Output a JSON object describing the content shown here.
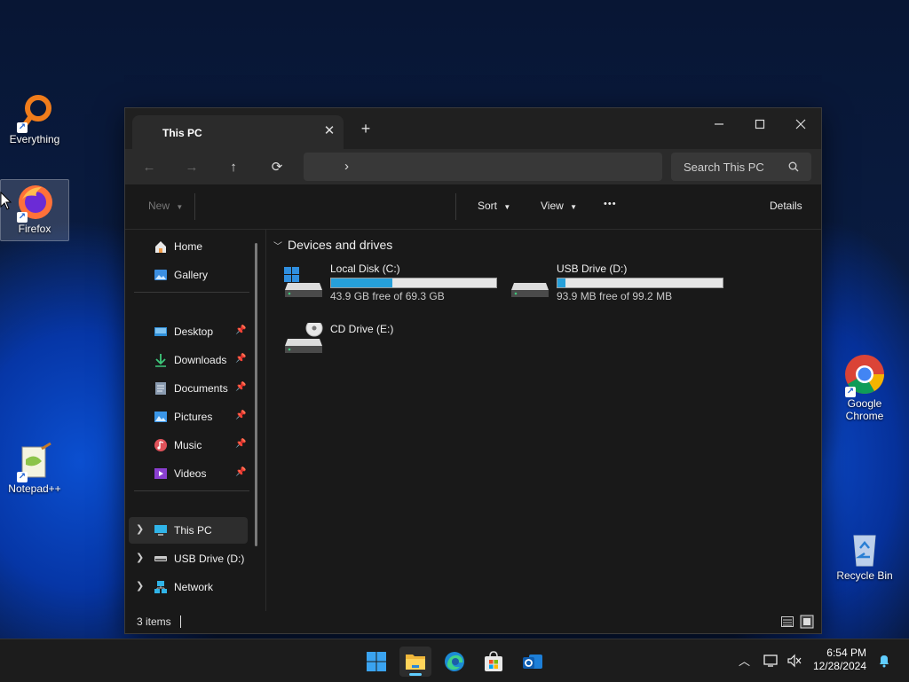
{
  "desktop": {
    "icons": [
      {
        "label": "Everything"
      },
      {
        "label": "Firefox"
      },
      {
        "label": "Notepad++"
      },
      {
        "label": "Google\nChrome",
        "line1": "Google",
        "line2": "Chrome"
      },
      {
        "label": "Recycle Bin"
      }
    ]
  },
  "window": {
    "tab_title": "This PC",
    "new_tab": "+",
    "nav": {
      "back": "←",
      "forward": "→",
      "up": "↑",
      "refresh": "⟳",
      "breadcrumb_sep": "›"
    },
    "search": {
      "placeholder": "Search This PC"
    },
    "commands": {
      "new": "New",
      "sort": "Sort",
      "view": "View",
      "more": "•••",
      "details": "Details"
    },
    "sidebar": {
      "items": [
        {
          "label": "Home",
          "icon": "home-icon"
        },
        {
          "label": "Gallery",
          "icon": "gallery-icon"
        },
        {
          "label": "Desktop",
          "icon": "desktop-folder-icon",
          "pinned": true
        },
        {
          "label": "Downloads",
          "icon": "downloads-icon",
          "pinned": true
        },
        {
          "label": "Documents",
          "icon": "documents-icon",
          "pinned": true
        },
        {
          "label": "Pictures",
          "icon": "pictures-icon",
          "pinned": true
        },
        {
          "label": "Music",
          "icon": "music-icon",
          "pinned": true
        },
        {
          "label": "Videos",
          "icon": "videos-icon",
          "pinned": true
        },
        {
          "label": "This PC",
          "icon": "this-pc-icon",
          "selected": true
        },
        {
          "label": "USB Drive (D:)",
          "icon": "usb-drive-icon"
        },
        {
          "label": "Network",
          "icon": "network-icon"
        }
      ]
    },
    "content": {
      "group_header": "Devices and drives",
      "drives": [
        {
          "name": "Local Disk (C:)",
          "free_text": "43.9 GB free of 69.3 GB",
          "used_fraction": 0.37
        },
        {
          "name": "USB Drive (D:)",
          "free_text": "93.9 MB free of 99.2 MB",
          "used_fraction": 0.05
        },
        {
          "name": "CD Drive (E:)"
        }
      ]
    },
    "status": {
      "item_count": "3 items"
    }
  },
  "taskbar": {
    "clock_time": "6:54 PM",
    "clock_date": "12/28/2024",
    "tray_overflow": "^"
  },
  "colors": {
    "accent": "#26a0da",
    "window_bg": "#191919",
    "taskbar_indicator": "#60cdff"
  }
}
